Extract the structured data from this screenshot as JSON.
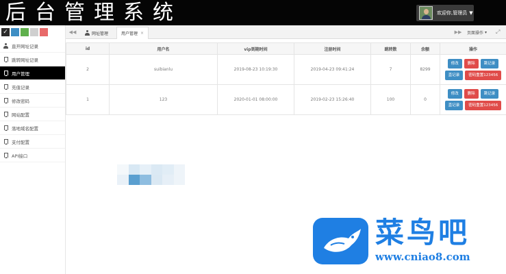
{
  "header": {
    "title": "后台管理系统",
    "user_greeting": "欢迎你,管理员"
  },
  "sidebar": {
    "theme_swatches": [
      "#2a2a2a",
      "#3e8ec4",
      "#5fb04c",
      "#cfcfcf",
      "#e86a6a"
    ],
    "items": [
      {
        "label": "直开网址记录",
        "icon": "user-icon"
      },
      {
        "label": "跳转网址记录",
        "icon": "bookmark-icon"
      },
      {
        "label": "用户管理",
        "icon": "bookmark-icon",
        "active": true
      },
      {
        "label": "充值记录",
        "icon": "bookmark-icon"
      },
      {
        "label": "修改密码",
        "icon": "bookmark-icon"
      },
      {
        "label": "网站配置",
        "icon": "bookmark-icon"
      },
      {
        "label": "落地域名配置",
        "icon": "bookmark-icon"
      },
      {
        "label": "支付配置",
        "icon": "bookmark-icon"
      },
      {
        "label": "API接口",
        "icon": "bookmark-icon"
      }
    ]
  },
  "tabs": {
    "items": [
      {
        "label": "网址管理",
        "icon": "user-icon"
      },
      {
        "label": "用户管理",
        "closable": true,
        "active": true
      }
    ],
    "page_actions": "页面操作"
  },
  "table": {
    "columns": [
      "id",
      "用户名",
      "vip到期时间",
      "注册时间",
      "跳转数",
      "余额",
      "操作"
    ],
    "rows": [
      {
        "id": "2",
        "username": "suibianlu",
        "vip_expire": "2019-08-23 10:19:30",
        "register": "2019-04-23 09:41:24",
        "jumps": "7",
        "balance": "8299"
      },
      {
        "id": "1",
        "username": "123",
        "vip_expire": "2020-01-01 08:00:00",
        "register": "2019-02-23 15:26:40",
        "jumps": "100",
        "balance": "0"
      }
    ],
    "actions": {
      "edit": "修改",
      "delete": "删除",
      "jump_log": "跳记录",
      "direct_log": "直记录",
      "reset_password": "密码重置123456"
    }
  },
  "watermark": {
    "title": "菜鸟吧",
    "url": "www.cniao8.com",
    "color": "#1f7fe3"
  }
}
